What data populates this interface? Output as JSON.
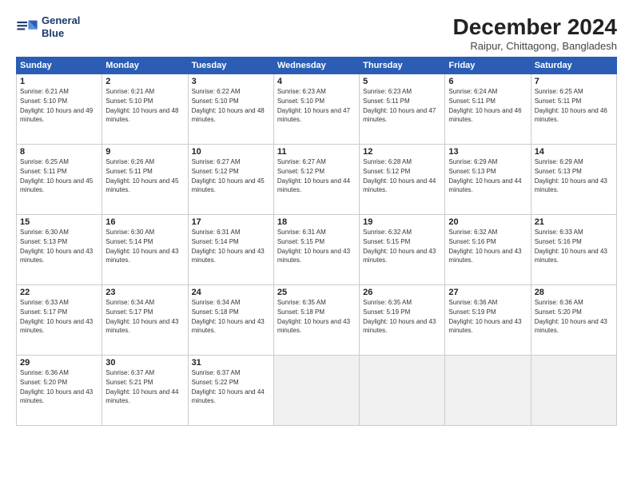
{
  "header": {
    "logo_line1": "General",
    "logo_line2": "Blue",
    "month_title": "December 2024",
    "subtitle": "Raipur, Chittagong, Bangladesh"
  },
  "weekdays": [
    "Sunday",
    "Monday",
    "Tuesday",
    "Wednesday",
    "Thursday",
    "Friday",
    "Saturday"
  ],
  "weeks": [
    [
      {
        "day": 1,
        "sunrise": "6:21 AM",
        "sunset": "5:10 PM",
        "daylight": "10 hours and 49 minutes."
      },
      {
        "day": 2,
        "sunrise": "6:21 AM",
        "sunset": "5:10 PM",
        "daylight": "10 hours and 48 minutes."
      },
      {
        "day": 3,
        "sunrise": "6:22 AM",
        "sunset": "5:10 PM",
        "daylight": "10 hours and 48 minutes."
      },
      {
        "day": 4,
        "sunrise": "6:23 AM",
        "sunset": "5:10 PM",
        "daylight": "10 hours and 47 minutes."
      },
      {
        "day": 5,
        "sunrise": "6:23 AM",
        "sunset": "5:11 PM",
        "daylight": "10 hours and 47 minutes."
      },
      {
        "day": 6,
        "sunrise": "6:24 AM",
        "sunset": "5:11 PM",
        "daylight": "10 hours and 46 minutes."
      },
      {
        "day": 7,
        "sunrise": "6:25 AM",
        "sunset": "5:11 PM",
        "daylight": "10 hours and 46 minutes."
      }
    ],
    [
      {
        "day": 8,
        "sunrise": "6:25 AM",
        "sunset": "5:11 PM",
        "daylight": "10 hours and 45 minutes."
      },
      {
        "day": 9,
        "sunrise": "6:26 AM",
        "sunset": "5:11 PM",
        "daylight": "10 hours and 45 minutes."
      },
      {
        "day": 10,
        "sunrise": "6:27 AM",
        "sunset": "5:12 PM",
        "daylight": "10 hours and 45 minutes."
      },
      {
        "day": 11,
        "sunrise": "6:27 AM",
        "sunset": "5:12 PM",
        "daylight": "10 hours and 44 minutes."
      },
      {
        "day": 12,
        "sunrise": "6:28 AM",
        "sunset": "5:12 PM",
        "daylight": "10 hours and 44 minutes."
      },
      {
        "day": 13,
        "sunrise": "6:29 AM",
        "sunset": "5:13 PM",
        "daylight": "10 hours and 44 minutes."
      },
      {
        "day": 14,
        "sunrise": "6:29 AM",
        "sunset": "5:13 PM",
        "daylight": "10 hours and 43 minutes."
      }
    ],
    [
      {
        "day": 15,
        "sunrise": "6:30 AM",
        "sunset": "5:13 PM",
        "daylight": "10 hours and 43 minutes."
      },
      {
        "day": 16,
        "sunrise": "6:30 AM",
        "sunset": "5:14 PM",
        "daylight": "10 hours and 43 minutes."
      },
      {
        "day": 17,
        "sunrise": "6:31 AM",
        "sunset": "5:14 PM",
        "daylight": "10 hours and 43 minutes."
      },
      {
        "day": 18,
        "sunrise": "6:31 AM",
        "sunset": "5:15 PM",
        "daylight": "10 hours and 43 minutes."
      },
      {
        "day": 19,
        "sunrise": "6:32 AM",
        "sunset": "5:15 PM",
        "daylight": "10 hours and 43 minutes."
      },
      {
        "day": 20,
        "sunrise": "6:32 AM",
        "sunset": "5:16 PM",
        "daylight": "10 hours and 43 minutes."
      },
      {
        "day": 21,
        "sunrise": "6:33 AM",
        "sunset": "5:16 PM",
        "daylight": "10 hours and 43 minutes."
      }
    ],
    [
      {
        "day": 22,
        "sunrise": "6:33 AM",
        "sunset": "5:17 PM",
        "daylight": "10 hours and 43 minutes."
      },
      {
        "day": 23,
        "sunrise": "6:34 AM",
        "sunset": "5:17 PM",
        "daylight": "10 hours and 43 minutes."
      },
      {
        "day": 24,
        "sunrise": "6:34 AM",
        "sunset": "5:18 PM",
        "daylight": "10 hours and 43 minutes."
      },
      {
        "day": 25,
        "sunrise": "6:35 AM",
        "sunset": "5:18 PM",
        "daylight": "10 hours and 43 minutes."
      },
      {
        "day": 26,
        "sunrise": "6:35 AM",
        "sunset": "5:19 PM",
        "daylight": "10 hours and 43 minutes."
      },
      {
        "day": 27,
        "sunrise": "6:36 AM",
        "sunset": "5:19 PM",
        "daylight": "10 hours and 43 minutes."
      },
      {
        "day": 28,
        "sunrise": "6:36 AM",
        "sunset": "5:20 PM",
        "daylight": "10 hours and 43 minutes."
      }
    ],
    [
      {
        "day": 29,
        "sunrise": "6:36 AM",
        "sunset": "5:20 PM",
        "daylight": "10 hours and 43 minutes."
      },
      {
        "day": 30,
        "sunrise": "6:37 AM",
        "sunset": "5:21 PM",
        "daylight": "10 hours and 44 minutes."
      },
      {
        "day": 31,
        "sunrise": "6:37 AM",
        "sunset": "5:22 PM",
        "daylight": "10 hours and 44 minutes."
      },
      null,
      null,
      null,
      null
    ]
  ]
}
